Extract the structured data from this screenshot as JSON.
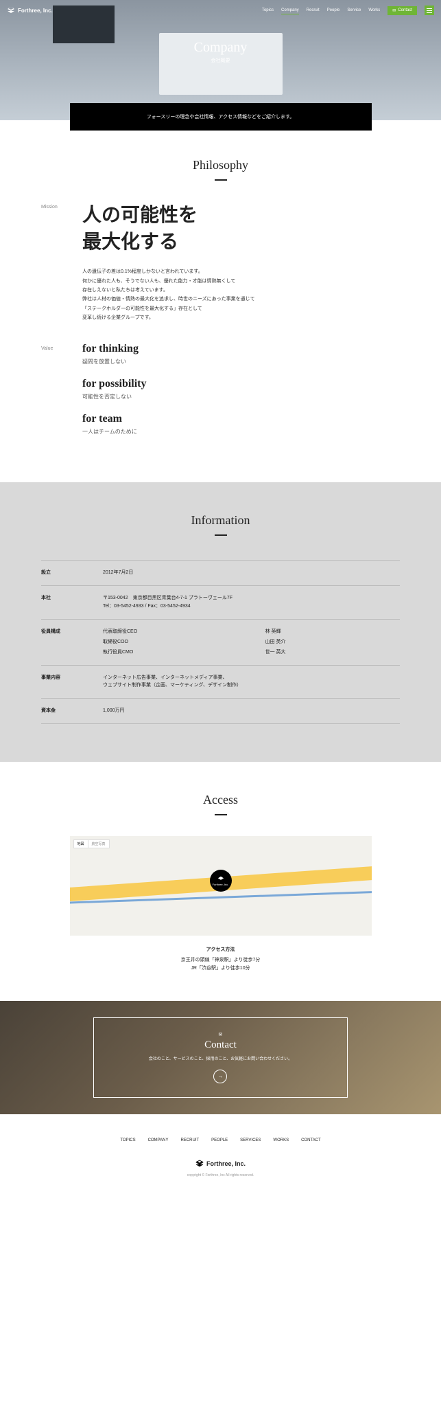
{
  "header": {
    "logo": "Forthree, Inc.",
    "nav": [
      "Topics",
      "Company",
      "Recruit",
      "People",
      "Service",
      "Works"
    ],
    "contact": "Contact"
  },
  "hero": {
    "title": "Company",
    "subtitle": "会社概要",
    "lead": "フォースリーの理念や会社情報、アクセス情報などをご紹介します。"
  },
  "philosophy": {
    "title": "Philosophy",
    "mission_label": "Mission",
    "mission_heading": "人の可能性を\n最大化する",
    "mission_body": "人の遺伝子の差は0.1%程度しかないと言われています。\n何かに優れた人も、そうでない人も、優れた能力・才能は情熱無くして\n存在しえないと私たちは考えています。\n弊社は人材の価値・情熱の最大化を追求し、時世のニーズにあった事業を通じて\n「ステークホルダーの可能性を最大化する」存在として\n変革し続ける企業グループです。",
    "value_label": "Value",
    "values": [
      {
        "h": "for thinking",
        "p": "疑問を放置しない"
      },
      {
        "h": "for possibility",
        "p": "可能性を否定しない"
      },
      {
        "h": "for team",
        "p": "一人はチームのために"
      }
    ]
  },
  "info": {
    "title": "Information",
    "rows": {
      "founded_l": "設立",
      "founded_v": "2012年7月2日",
      "hq_l": "本社",
      "hq_v": "〒153-0042　東京都目黒区青葉台4-7-1 プラトーヴェール7F\nTel：03-5452-4933 / Fax：03-5452-4934",
      "officers_l": "役員構成",
      "officers": [
        [
          "代表取締役CEO",
          "林 英輝"
        ],
        [
          "取締役COO",
          "山田 英介"
        ],
        [
          "執行役員CMO",
          "世一 英大"
        ]
      ],
      "biz_l": "事業内容",
      "biz_v": "インターネット広告事業、インターネットメディア事業、\nウェブサイト制作事業（企画、マーケティング、デザイン制作）",
      "capital_l": "資本金",
      "capital_v": "1,000万円"
    }
  },
  "access": {
    "title": "Access",
    "map_tabs": [
      "地図",
      "航空写真"
    ],
    "pin": "Forthree, Inc.",
    "heading": "アクセス方法",
    "line1": "京王井の頭線「神泉駅」より徒歩7分",
    "line2": "JR「渋谷駅」より徒歩10分"
  },
  "contact": {
    "title": "Contact",
    "body": "会社のこと、サービスのこと、採用のこと、お気軽にお問い合わせください。",
    "arrow": "→"
  },
  "footer": {
    "nav": [
      "TOPICS",
      "COMPANY",
      "RECRUIT",
      "PEOPLE",
      "SERVICES",
      "WORKS",
      "CONTACT"
    ],
    "logo": "Forthree, Inc.",
    "copy": "copyright © Forthree, Inc All rights reserved."
  }
}
